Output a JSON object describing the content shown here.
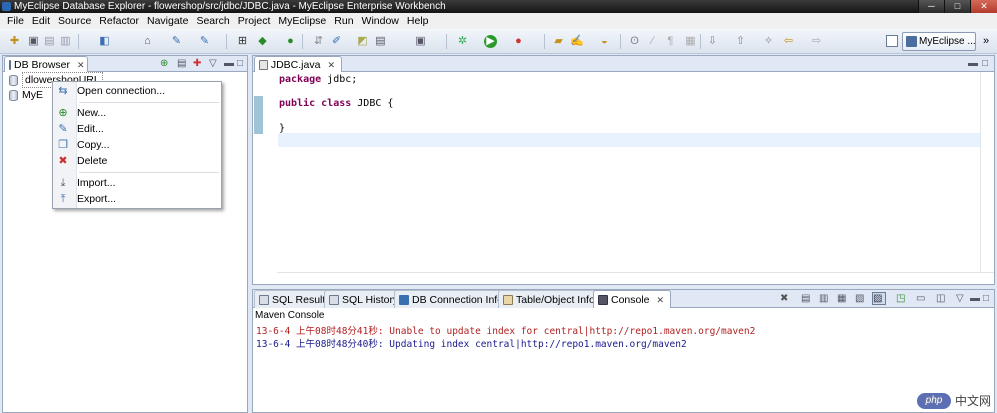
{
  "window": {
    "title": "MyEclipse Database Explorer - flowershop/src/jdbc/JDBC.java - MyEclipse Enterprise Workbench",
    "minimize": "─",
    "maximize": "□",
    "close": "✕"
  },
  "menubar": [
    "File",
    "Edit",
    "Source",
    "Refactor",
    "Navigate",
    "Search",
    "Project",
    "MyEclipse",
    "Run",
    "Window",
    "Help"
  ],
  "toolbar": {
    "perspective_label": "MyEclipse ...",
    "perspective_more": "»"
  },
  "db_browser": {
    "tab_label": "DB Browser",
    "items": [
      "dlowershopURL",
      "MyE"
    ],
    "context_menu": {
      "open_connection": "Open connection...",
      "new": "New...",
      "edit": "Edit...",
      "copy": "Copy...",
      "delete": "Delete",
      "import": "Import...",
      "export": "Export..."
    }
  },
  "editor": {
    "tab_label": "JDBC.java",
    "lines": {
      "l1_kw": "package",
      "l1_rest": " jdbc;",
      "l3_kw1": "public",
      "l3_kw2": "class",
      "l3_rest": " JDBC {",
      "l5": "}"
    }
  },
  "bottom": {
    "tabs": [
      "SQL Results",
      "SQL History",
      "DB Connection Info",
      "Table/Object Info",
      "Console"
    ],
    "console_title": "Maven Console",
    "console_lines": [
      {
        "text": "13-6-4 上午08时48分41秒: Unable to update index for central|http://repo1.maven.org/maven2",
        "color": "#b22222"
      },
      {
        "text": "13-6-4 上午08时48分40秒: Updating index central|http://repo1.maven.org/maven2",
        "color": "#1a1a8c"
      }
    ]
  },
  "watermark": {
    "logo": "php",
    "text": "中文网"
  }
}
